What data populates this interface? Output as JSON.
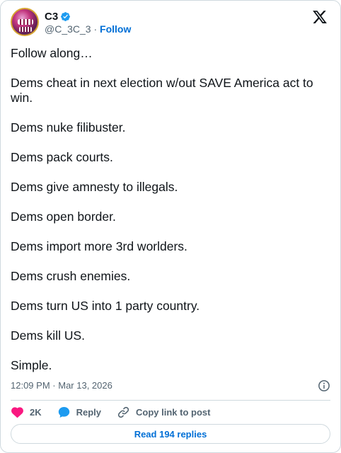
{
  "header": {
    "name": "C3",
    "handle": "@C_3C_3",
    "separator": "·",
    "follow_label": "Follow"
  },
  "post": {
    "lines": [
      "Follow along…",
      "Dems cheat in next election w/out SAVE America act to win.",
      "Dems nuke filibuster.",
      "Dems pack courts.",
      "Dems give amnesty to illegals.",
      "Dems open border.",
      "Dems import more 3rd worlders.",
      "Dems crush enemies.",
      "Dems turn US into 1 party country.",
      "Dems kill US.",
      "Simple."
    ]
  },
  "meta": {
    "time": "12:09 PM",
    "date": "Mar 13, 2026",
    "separator": "·"
  },
  "actions": {
    "like_count": "2K",
    "reply_label": "Reply",
    "copy_label": "Copy link to post"
  },
  "replies_button": "Read 194 replies",
  "icons": {
    "verified": "verified-badge-icon",
    "x_logo": "x-logo-icon",
    "info": "info-icon",
    "like": "heart-icon",
    "reply": "speech-bubble-icon",
    "copy": "link-icon"
  },
  "colors": {
    "accent": "#1d9bf0",
    "link": "#006fd6",
    "like": "#f91880",
    "muted": "#536471",
    "text": "#0f1419",
    "border": "#cfd9de"
  }
}
